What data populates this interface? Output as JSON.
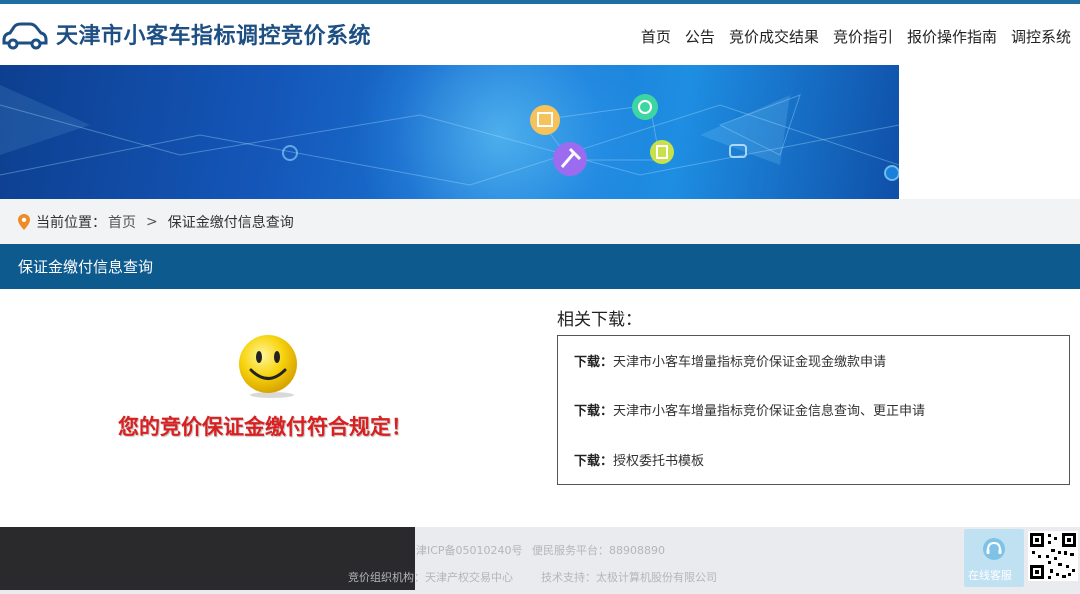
{
  "header": {
    "site_title": "天津市小客车指标调控竞价系统",
    "logo_icon": "car-icon",
    "nav": [
      "首页",
      "公告",
      "竞价成交结果",
      "竞价指引",
      "报价操作指南",
      "调控系统"
    ]
  },
  "breadcrumb": {
    "icon": "location-pin-icon",
    "prefix": "当前位置：",
    "home": "首页",
    "separator": ">",
    "current": "保证金缴付信息查询"
  },
  "section": {
    "title": "保证金缴付信息查询"
  },
  "result": {
    "icon": "smiley-icon",
    "message": "您的竞价保证金缴付符合规定！"
  },
  "downloads": {
    "heading": "相关下载：",
    "items": [
      {
        "key": "下载：",
        "label": "天津市小客车增量指标竞价保证金现金缴款申请"
      },
      {
        "key": "下载：",
        "label": "天津市小客车增量指标竞价保证金信息查询、更正申请"
      },
      {
        "key": "下载：",
        "label": "授权委托书模板"
      }
    ]
  },
  "footer": {
    "line1a": "津ICP备05010240号",
    "line1b": "便民服务平台：88908890",
    "line2a": "竞价组织机构：天津产权交易中心",
    "line2b": "技术支持：太极计算机股份有限公司",
    "online_service": "在线客服",
    "qr_icon": "qr-code-icon"
  },
  "colors": {
    "accent": "#0d5a8f",
    "title": "#1d4f83",
    "result_text": "#d91f1f"
  }
}
